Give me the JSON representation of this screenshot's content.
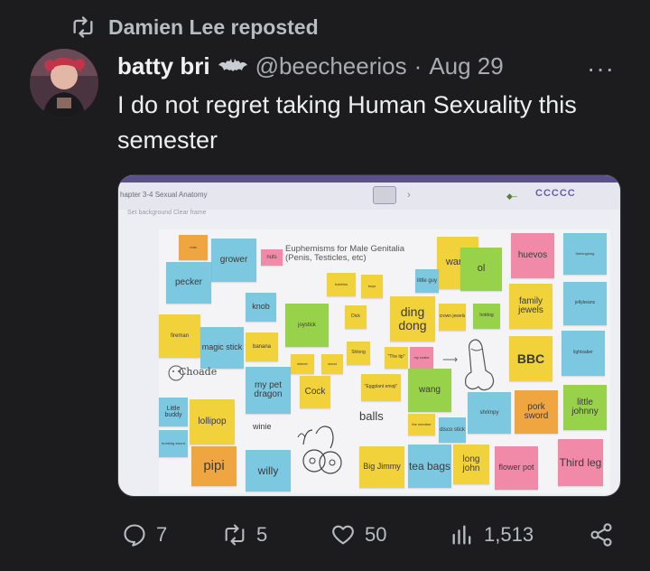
{
  "repost": {
    "text": "Damien Lee reposted"
  },
  "author": {
    "name": "batty bri",
    "handle": "@beecheerios",
    "separator": "·",
    "date": "Aug 29"
  },
  "more_label": "···",
  "tweet": {
    "text": "I do not regret taking Human Sexuality this semester"
  },
  "media": {
    "toolbar_title": "hapter 3-4 Sexual Anatomy",
    "toolbar_sub": "Set background     Clear frame",
    "toolbar_controls": "CCCCC",
    "board_title": "Euphemisms for Male Genitalia\n(Penis, Testicles, etc)",
    "notes": [
      {
        "text": "grower"
      },
      {
        "text": "nuts"
      },
      {
        "text": "pecker"
      },
      {
        "text": "knob"
      },
      {
        "text": "joystick"
      },
      {
        "text": "Dick"
      },
      {
        "text": "ding dong"
      },
      {
        "text": "crown jewels"
      },
      {
        "text": "hotdog"
      },
      {
        "text": "wang"
      },
      {
        "text": "ol"
      },
      {
        "text": "little guy"
      },
      {
        "text": "huevos"
      },
      {
        "text": "thelonglong"
      },
      {
        "text": "family jewels"
      },
      {
        "text": "jellybeans"
      },
      {
        "text": "fireman"
      },
      {
        "text": "magic stick"
      },
      {
        "text": "banana"
      },
      {
        "text": "Shlong"
      },
      {
        "text": "\"The tip\""
      },
      {
        "text": "lightsaber"
      },
      {
        "text": "BBC"
      },
      {
        "text": "my pet dragon"
      },
      {
        "text": "Cock"
      },
      {
        "text": "\"Eggplant emoji\""
      },
      {
        "text": "wang"
      },
      {
        "text": "little johnny"
      },
      {
        "text": "pork sword"
      },
      {
        "text": "shrimpy"
      },
      {
        "text": "Little buddy"
      },
      {
        "text": "lollipop"
      },
      {
        "text": "balls"
      },
      {
        "text": "disco stick"
      },
      {
        "text": "winie"
      },
      {
        "text": "pipi"
      },
      {
        "text": "willy"
      },
      {
        "text": "Big Jimmy"
      },
      {
        "text": "tea bags"
      },
      {
        "text": "long john"
      },
      {
        "text": "flower pot"
      },
      {
        "text": "Third leg"
      },
      {
        "text": "Choade"
      }
    ]
  },
  "actions": {
    "replies": "7",
    "reposts": "5",
    "likes": "50",
    "views": "1,513"
  },
  "colors": {
    "background": "#1c1c1e",
    "text": "#e7e9ea",
    "muted": "#a8acb1",
    "note_orange": "#f0a640",
    "note_blue": "#7cc8e0",
    "note_yellow": "#f2d23a",
    "note_green": "#98d24a",
    "note_pink": "#f08aa8"
  }
}
